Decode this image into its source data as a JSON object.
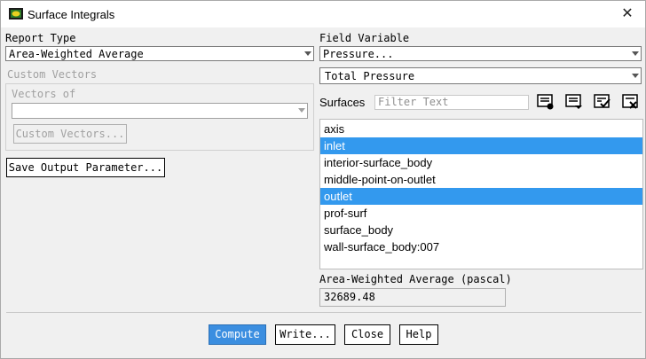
{
  "window": {
    "title": "Surface Integrals",
    "app_icon": "fluent-app-icon",
    "close_icon": "close-icon"
  },
  "report_type": {
    "label": "Report Type",
    "value": "Area-Weighted Average"
  },
  "custom_vectors": {
    "group_label": "Custom Vectors",
    "vectors_of_label": "Vectors of",
    "vectors_of_value": "",
    "button_label": "Custom Vectors..."
  },
  "save_output_label": "Save Output Parameter...",
  "field_variable": {
    "label": "Field Variable",
    "category": "Pressure...",
    "variable": "Total Pressure"
  },
  "surfaces": {
    "label": "Surfaces",
    "filter_placeholder": "Filter Text",
    "icons": [
      "new-surface-icon",
      "select-list-icon",
      "select-all-icon",
      "deselect-all-icon"
    ],
    "items": [
      {
        "label": "axis",
        "selected": false
      },
      {
        "label": "inlet",
        "selected": true
      },
      {
        "label": "interior-surface_body",
        "selected": false
      },
      {
        "label": "middle-point-on-outlet",
        "selected": false
      },
      {
        "label": "outlet",
        "selected": true
      },
      {
        "label": "prof-surf",
        "selected": false
      },
      {
        "label": "surface_body",
        "selected": false
      },
      {
        "label": "wall-surface_body:007",
        "selected": false
      }
    ]
  },
  "result": {
    "label": "Area-Weighted Average (pascal)",
    "value": "32689.48"
  },
  "buttons": {
    "compute": "Compute",
    "write": "Write...",
    "close": "Close",
    "help": "Help"
  },
  "colors": {
    "selection": "#3399ee",
    "compute_button": "#3b8ee0"
  }
}
